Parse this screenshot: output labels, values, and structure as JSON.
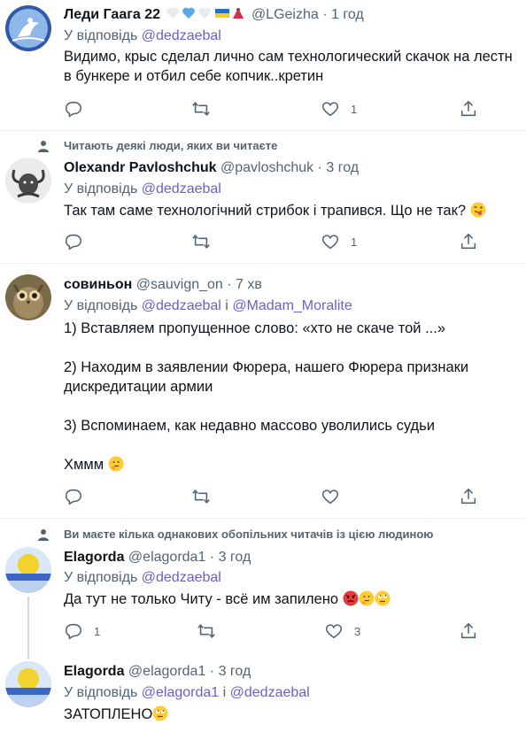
{
  "tweets": [
    {
      "name": "Леди Гаага 22",
      "handle": "@LGeizha",
      "time": "1 год",
      "reply_prefix": "У відповідь",
      "mentions": [
        "@dedzaebal"
      ],
      "mention_joiner": "",
      "text": "Видимо, крыс сделал лично сам технологический скачок на лестн\nв бункере и отбил себе копчик..кретин",
      "replies": "",
      "retweets": "",
      "likes": "1"
    },
    {
      "context": "Читають деякі люди, яких ви читаєте",
      "name": "Olexandr Pavloshchuk",
      "handle": "@pavloshchuk",
      "time": "3 год",
      "reply_prefix": "У відповідь",
      "mentions": [
        "@dedzaebal"
      ],
      "mention_joiner": "",
      "text": "Так там саме технологічний стрибок і трапився. Що не так?",
      "replies": "",
      "retweets": "",
      "likes": "1"
    },
    {
      "name": "совиньон",
      "handle": "@sauvign_on",
      "time": "7 хв",
      "reply_prefix": "У відповідь",
      "mentions": [
        "@dedzaebal",
        "@Madam_Moralite"
      ],
      "mention_joiner": "і",
      "text_lines": [
        "1) Вставляем пропущенное слово: «хто не скаче той ...»",
        "2) Находим в заявлении Фюрера, нашего Фюрера признаки\nдискредитации армии",
        "3) Вспоминаем, как недавно массово уволились судьи",
        "Хммм"
      ],
      "replies": "",
      "retweets": "",
      "likes": ""
    },
    {
      "context": "Ви маєте кілька однакових обопільних читачів із цією людиною",
      "name": "Elagorda",
      "handle": "@elagorda1",
      "time": "3 год",
      "reply_prefix": "У відповідь",
      "mentions": [
        "@dedzaebal"
      ],
      "mention_joiner": "",
      "text": "Да тут не только Читу - всё им запилено",
      "replies": "1",
      "retweets": "",
      "likes": "3"
    },
    {
      "name": "Elagorda",
      "handle": "@elagorda1",
      "time": "3 год",
      "reply_prefix": "У відповідь",
      "mentions": [
        "@elagorda1",
        "@dedzaebal"
      ],
      "mention_joiner": "і",
      "text": "ЗАТОПЛЕНО"
    }
  ],
  "dot": "·",
  "colors": {
    "text": "#0f1419",
    "secondary": "#536471",
    "mention": "#6b5fc9",
    "separator": "#eff3f4"
  },
  "icons": [
    "reply-icon",
    "retweet-icon",
    "like-icon",
    "share-icon",
    "person-icon"
  ]
}
